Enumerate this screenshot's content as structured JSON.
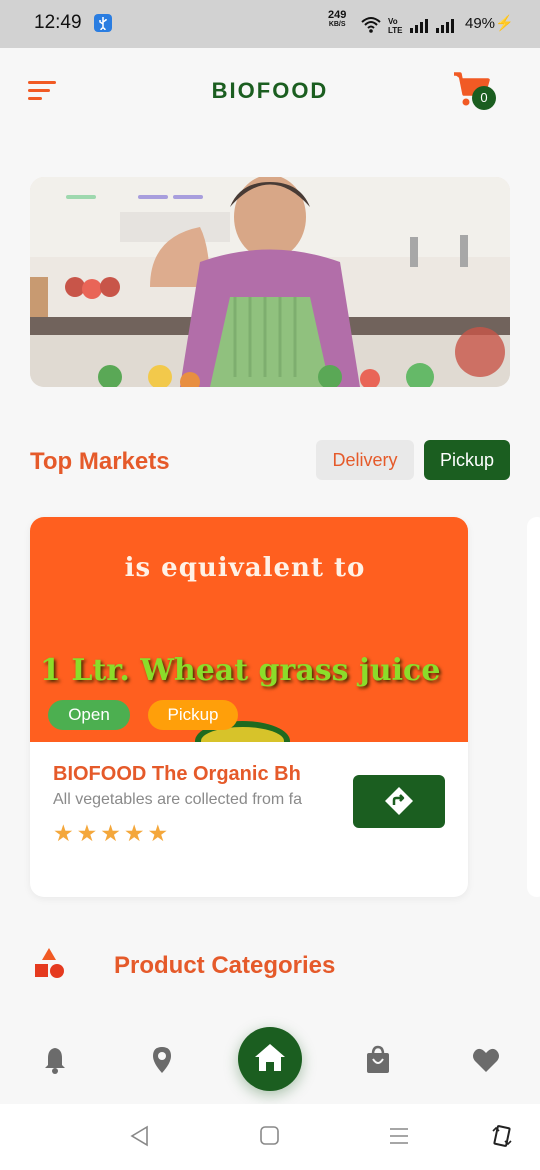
{
  "status_bar": {
    "time": "12:49",
    "net_speed_value": "249",
    "net_speed_unit": "KB/S",
    "volte_label": "Vo LTE",
    "battery": "49%"
  },
  "header": {
    "title": "BIOFOOD",
    "cart_count": "0"
  },
  "banner": {
    "active_indicator_color": "#8fd3a2",
    "indicator_color": "#9b8fd9"
  },
  "top_markets": {
    "title": "Top Markets",
    "tabs": [
      {
        "label": "Delivery",
        "active": false
      },
      {
        "label": "Pickup",
        "active": true
      }
    ],
    "cards": [
      {
        "image_text_line1": "is equivalent  to",
        "image_text_line2": "1 Ltr. Wheat grass juice",
        "open_badge": "Open",
        "mode_badge": "Pickup",
        "name": "BIOFOOD The Organic Bh",
        "description": "All vegetables are collected from fa",
        "rating": 5,
        "stars_text": "★★★★★"
      }
    ]
  },
  "categories": {
    "title": "Product Categories"
  },
  "bottom_nav": {
    "items": [
      "bell-icon",
      "location-pin-icon",
      "home-icon",
      "shopping-bag-icon",
      "heart-icon"
    ],
    "active": "home-icon"
  },
  "colors": {
    "brand_green": "#1b5e20",
    "accent_orange": "#e55a2a",
    "open_green": "#4caf50",
    "pickup_orange": "#ff9f0a",
    "star": "#f4a73b"
  }
}
